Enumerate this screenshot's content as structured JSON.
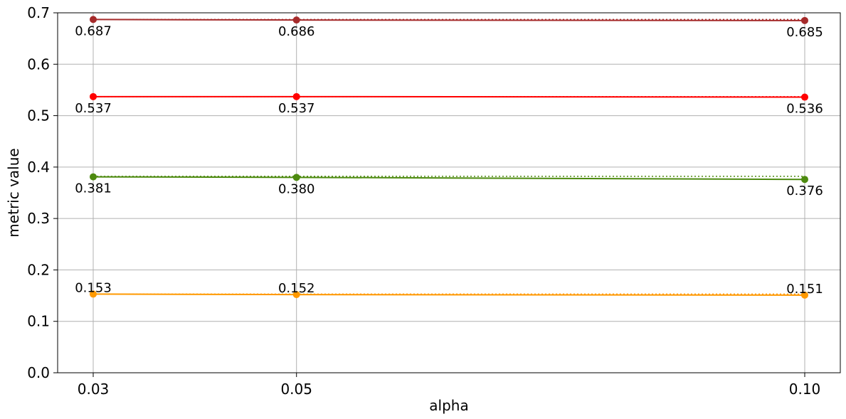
{
  "chart_data": {
    "type": "line",
    "xlabel": "alpha",
    "ylabel": "metric value",
    "x": [
      0.03,
      0.05,
      0.1
    ],
    "x_tick_labels": [
      "0.03",
      "0.05",
      "0.10"
    ],
    "y_ticks": [
      0.0,
      0.1,
      0.2,
      0.3,
      0.4,
      0.5,
      0.6,
      0.7
    ],
    "y_tick_labels": [
      "0.0",
      "0.1",
      "0.2",
      "0.3",
      "0.4",
      "0.5",
      "0.6",
      "0.7"
    ],
    "xlim": [
      0.0265,
      0.1035
    ],
    "ylim": [
      0.0,
      0.7
    ],
    "grid": true,
    "series": [
      {
        "color": "#a52a2a",
        "values": [
          0.687,
          0.686,
          0.685
        ],
        "labels": [
          "0.687",
          "0.686",
          "0.685"
        ],
        "label_position": "below",
        "reference_value": 0.687
      },
      {
        "color": "#ff0000",
        "values": [
          0.537,
          0.537,
          0.536
        ],
        "labels": [
          "0.537",
          "0.537",
          "0.536"
        ],
        "label_position": "below",
        "reference_value": 0.537
      },
      {
        "color": "#4d8a0f",
        "values": [
          0.381,
          0.38,
          0.376
        ],
        "labels": [
          "0.381",
          "0.380",
          "0.376"
        ],
        "label_position": "below",
        "reference_value": 0.382
      },
      {
        "color": "#ff9900",
        "values": [
          0.153,
          0.152,
          0.151
        ],
        "labels": [
          "0.153",
          "0.152",
          "0.151"
        ],
        "label_position": "above",
        "reference_value": 0.153
      }
    ]
  }
}
